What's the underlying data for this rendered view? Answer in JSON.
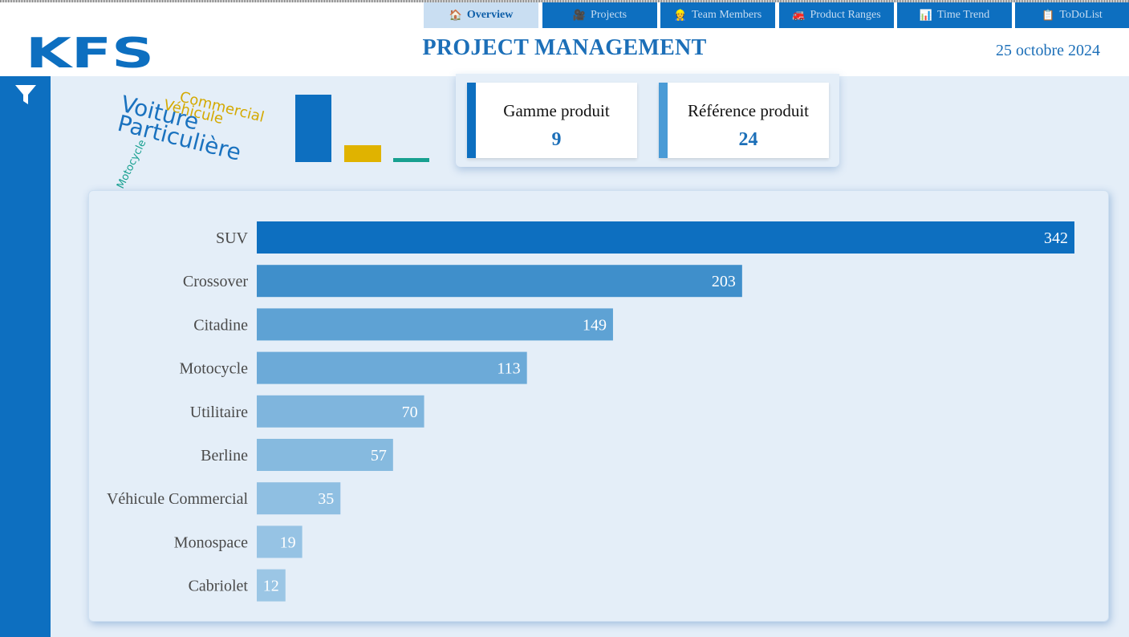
{
  "tabs": [
    {
      "label": "Overview",
      "icon": "🏠",
      "icon_name": "home-icon",
      "active": true
    },
    {
      "label": "Projects",
      "icon": "🎥",
      "icon_name": "projector-icon",
      "active": false
    },
    {
      "label": "Team Members",
      "icon": "👷",
      "icon_name": "worker-icon",
      "active": false
    },
    {
      "label": "Product Ranges",
      "icon": "🚒",
      "icon_name": "truck-icon",
      "active": false
    },
    {
      "label": "Time Trend",
      "icon": "📊",
      "icon_name": "chart-icon",
      "active": false
    },
    {
      "label": "ToDoList",
      "icon": "📋",
      "icon_name": "clipboard-icon",
      "active": false
    }
  ],
  "header": {
    "logo_text": "KFS",
    "title": "PROJECT MANAGEMENT",
    "date": "25 octobre 2024"
  },
  "sidebar": {
    "filter_icon": "filter-icon"
  },
  "word_cloud": {
    "words": [
      {
        "text": "Voiture",
        "color": "#1a72bf"
      },
      {
        "text": "Particulière",
        "color": "#1a72bf"
      },
      {
        "text": "Commercial",
        "color": "#d4a900"
      },
      {
        "text": "Véhicule",
        "color": "#d4a900"
      },
      {
        "text": "Motocycle",
        "color": "#17a090"
      }
    ]
  },
  "mini_bar_colors": [
    "#0d6fc0",
    "#e0b300",
    "#17a090"
  ],
  "kpis": [
    {
      "label": "Gamme produit",
      "value": "9",
      "accent": "#0d6fc0"
    },
    {
      "label": "Référence produit",
      "value": "24",
      "accent": "#4a9bd6"
    }
  ],
  "chart_data": {
    "type": "bar",
    "orientation": "horizontal",
    "categories": [
      "SUV",
      "Crossover",
      "Citadine",
      "Motocycle",
      "Utilitaire",
      "Berline",
      "Véhicule Commercial",
      "Monospace",
      "Cabriolet"
    ],
    "values": [
      342,
      203,
      149,
      113,
      70,
      57,
      35,
      19,
      12
    ],
    "colors": [
      "#0d6fc0",
      "#3f8fcb",
      "#5ea2d4",
      "#6caad8",
      "#7fb5dd",
      "#86badf",
      "#8fbfe2",
      "#96c3e4",
      "#9bc6e5"
    ],
    "label_color": "#4a4a4a",
    "value_label_color": "#ffffff",
    "xlim": [
      0,
      342
    ]
  }
}
